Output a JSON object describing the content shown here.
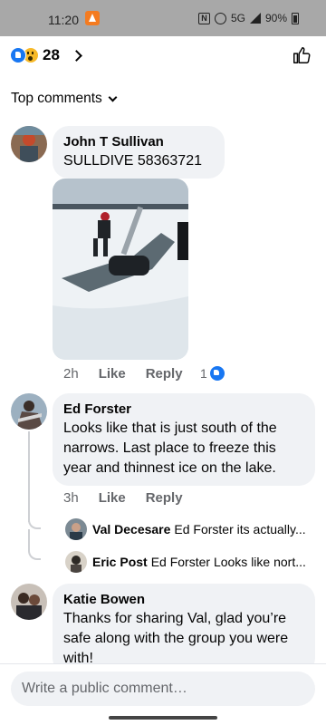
{
  "status_bar": {
    "time": "11:20",
    "network": "5G",
    "battery": "90%"
  },
  "reactions": {
    "types": [
      "like-icon",
      "wow-icon"
    ],
    "count": "28"
  },
  "sort": {
    "label": "Top comments"
  },
  "comments": [
    {
      "author": "John T Sullivan",
      "text": "SULLDIVE 58363721",
      "has_photo": true,
      "time": "2h",
      "like_label": "Like",
      "reply_label": "Reply",
      "reaction_count": "1"
    },
    {
      "author": "Ed Forster",
      "text": "Looks like that is just south of the narrows. Last place to freeze this year and thinnest ice on the lake.",
      "time": "3h",
      "like_label": "Like",
      "reply_label": "Reply",
      "replies": [
        {
          "author": "Val Decesare",
          "text": "Ed Forster its actually..."
        },
        {
          "author": "Eric Post",
          "text": "Ed Forster Looks like nort..."
        }
      ]
    },
    {
      "author": "Katie Bowen",
      "text": "Thanks for sharing Val, glad you’re safe along with the group you were with!"
    }
  ],
  "composer": {
    "placeholder": "Write a public comment…"
  },
  "colors": {
    "accent": "#1877f2",
    "bubble": "#f0f2f5",
    "secondary_text": "#65676b"
  }
}
